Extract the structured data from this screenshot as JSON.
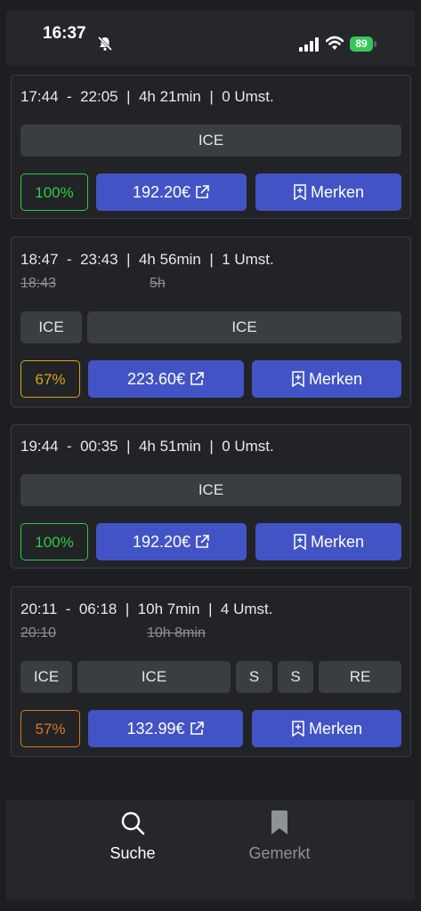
{
  "status": {
    "time": "16:37",
    "battery": "89"
  },
  "colors": {
    "accent": "#4254c5",
    "green": "#2ecc40",
    "yellow": "#d7a518",
    "orange": "#d9791d"
  },
  "connections": [
    {
      "times": "17:44  -  22:05  |  4h 21min  |  0 Umst.",
      "old_dep": "",
      "old_dur": "",
      "segments": [
        "ICE"
      ],
      "percent": "100%",
      "price": "192.20€",
      "save_label": "Merken"
    },
    {
      "times": "18:47  -  23:43  |  4h 56min  |  1 Umst.",
      "old_dep": "18:43",
      "old_dur": "5h",
      "segments": [
        "ICE",
        "ICE"
      ],
      "percent": "67%",
      "price": "223.60€",
      "save_label": "Merken"
    },
    {
      "times": "19:44  -  00:35  |  4h 51min  |  0 Umst.",
      "old_dep": "",
      "old_dur": "",
      "segments": [
        "ICE"
      ],
      "percent": "100%",
      "price": "192.20€",
      "save_label": "Merken"
    },
    {
      "times": "20:11  -  06:18  |  10h 7min  |  4 Umst.",
      "old_dep": "20:10",
      "old_dur": "10h 8min",
      "segments": [
        "ICE",
        "ICE",
        "S",
        "S",
        "RE"
      ],
      "percent": "57%",
      "price": "132.99€",
      "save_label": "Merken"
    }
  ],
  "tabs": {
    "search": "Suche",
    "saved": "Gemerkt"
  }
}
